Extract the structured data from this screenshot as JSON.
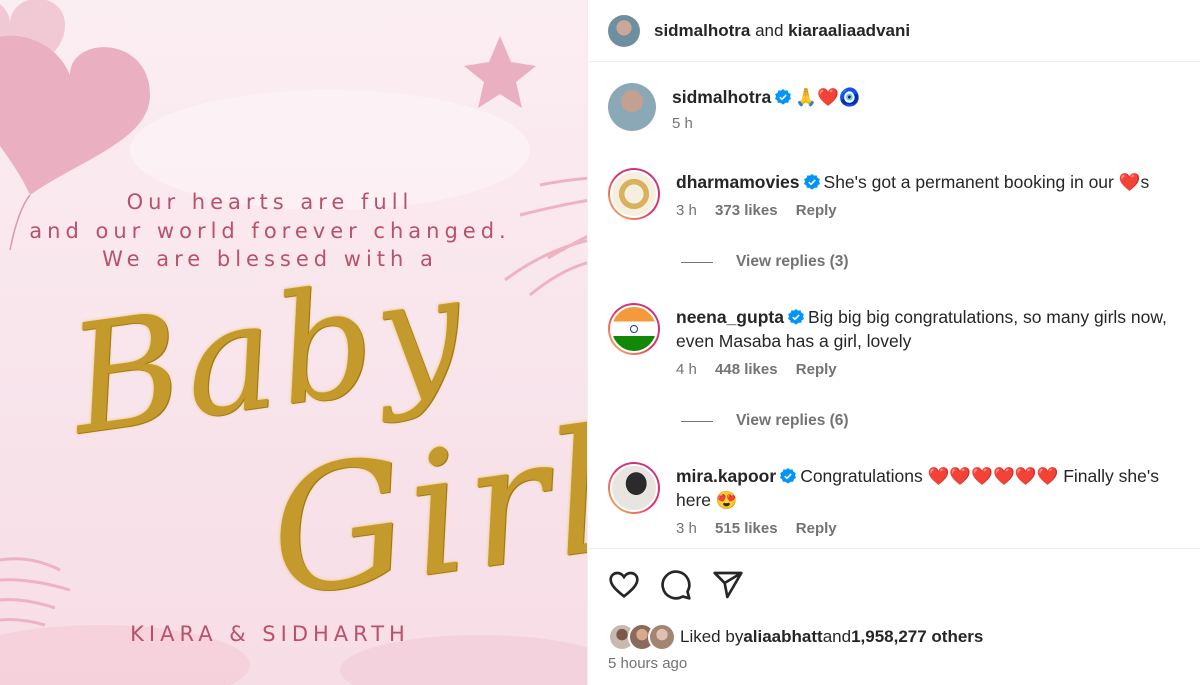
{
  "image": {
    "message_lines": [
      "Our hearts are full",
      "and our world forever changed.",
      "We are blessed with a"
    ],
    "script_baby": "Baby",
    "script_girl": "Girl",
    "names": "KIARA & SIDHARTH"
  },
  "header": {
    "user1": "sidmalhotra",
    "joiner": " and ",
    "user2": "kiaraaliaadvani"
  },
  "caption": {
    "username": "sidmalhotra",
    "text": "🙏❤️🧿",
    "time": "5 h"
  },
  "comments": [
    {
      "username": "dharmamovies",
      "text": "She's got a permanent booking in our ❤️s",
      "time": "3 h",
      "likes": "373 likes",
      "reply": "Reply",
      "view_replies": "View replies (3)"
    },
    {
      "username": "neena_gupta",
      "text": "Big big big congratulations, so many girls now, even Masaba has a girl, lovely",
      "time": "4 h",
      "likes": "448 likes",
      "reply": "Reply",
      "view_replies": "View replies (6)"
    },
    {
      "username": "mira.kapoor",
      "text": "Congratulations ❤️❤️❤️❤️❤️❤️ Finally she's here 😍",
      "time": "3 h",
      "likes": "515 likes",
      "reply": "Reply"
    }
  ],
  "footer": {
    "liked_prefix": "Liked by ",
    "liked_user": "aliaabhatt",
    "liked_mid": " and ",
    "liked_count": "1,958,277 others",
    "time_ago": "5 hours ago"
  },
  "colors": {
    "verified": "#0095f6",
    "pink_text": "#b8516c",
    "gold": "#c49a2c"
  }
}
